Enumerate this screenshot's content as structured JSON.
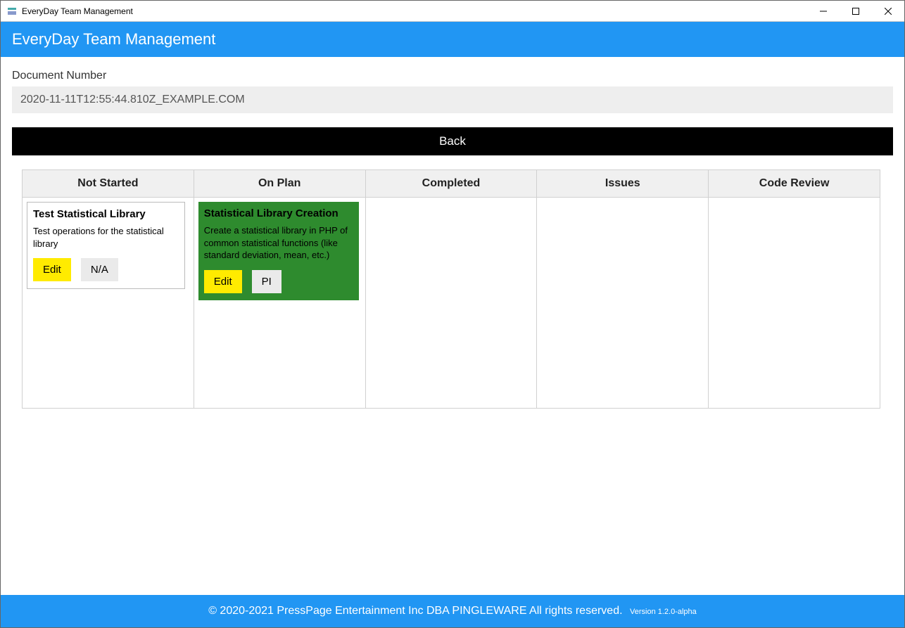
{
  "window": {
    "title": "EveryDay Team Management"
  },
  "header": {
    "title": "EveryDay Team Management"
  },
  "document": {
    "label": "Document Number",
    "value": "2020-11-11T12:55:44.810Z_EXAMPLE.COM"
  },
  "buttons": {
    "back": "Back"
  },
  "columns": [
    "Not Started",
    "On Plan",
    "Completed",
    "Issues",
    "Code Review"
  ],
  "cards": {
    "not_started": {
      "title": "Test Statistical Library",
      "desc": "Test operations for the statistical library",
      "edit": "Edit",
      "tag": "N/A"
    },
    "on_plan": {
      "title": "Statistical Library Creation",
      "desc": "Create a statistical library in PHP of common statistical functions (like standard deviation, mean, etc.)",
      "edit": "Edit",
      "tag": "PI"
    }
  },
  "footer": {
    "copyright": "© 2020-2021 PressPage Entertainment Inc DBA PINGLEWARE  All rights reserved.",
    "version": "Version 1.2.0-alpha"
  }
}
